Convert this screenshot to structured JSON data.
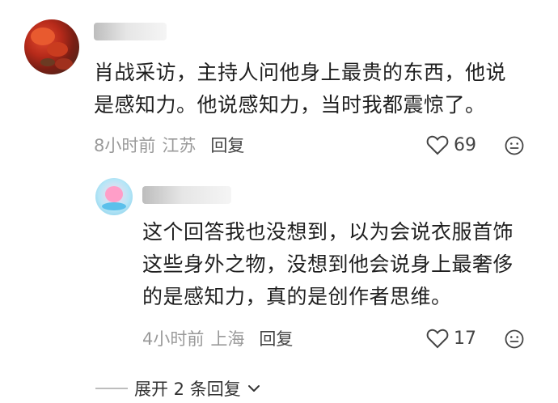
{
  "comment": {
    "text_line1": "肖战采访，主持人问他身上最贵的东西，他说",
    "text_line2": "是感知力。他说感知力，当时我都震惊了。",
    "time": "8小时前",
    "location": "江苏",
    "reply_label": "回复",
    "like_count": "69"
  },
  "reply": {
    "text_line1": "这个回答我也没想到，以为会说衣服首饰",
    "text_line2": "这些身外之物，没想到他会说身上最奢侈",
    "text_line3": "的是感知力，真的是创作者思维。",
    "time": "4小时前",
    "location": "上海",
    "reply_label": "回复",
    "like_count": "17"
  },
  "expand_label": "展开 2 条回复",
  "icons": {
    "like": "heart-outline-icon",
    "emoji": "smiley-icon",
    "expand": "chevron-down-icon"
  }
}
